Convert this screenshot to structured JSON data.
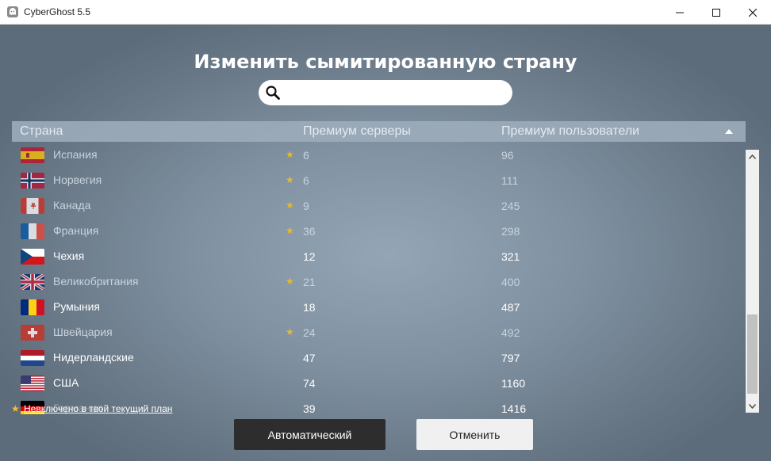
{
  "window": {
    "title": "CyberGhost 5.5",
    "app_icon": "ghost-icon",
    "controls": [
      "minimize-icon",
      "maximize-icon",
      "close-icon"
    ]
  },
  "heading": "Изменить сымитированную страну",
  "search": {
    "icon": "search-icon",
    "value": "",
    "placeholder": ""
  },
  "table": {
    "columns": [
      "Страна",
      "Премиум серверы",
      "Премиум пользователи"
    ],
    "sort": "ascending",
    "rows": [
      {
        "country": "Испания",
        "flag": "flag-spain",
        "premium": true,
        "servers": "6",
        "users": "96"
      },
      {
        "country": "Норвегия",
        "flag": "flag-norway",
        "premium": true,
        "servers": "6",
        "users": "111"
      },
      {
        "country": "Канада",
        "flag": "flag-canada",
        "premium": true,
        "servers": "9",
        "users": "245"
      },
      {
        "country": "Франция",
        "flag": "flag-france",
        "premium": true,
        "servers": "36",
        "users": "298"
      },
      {
        "country": "Чехия",
        "flag": "flag-czechia",
        "premium": false,
        "servers": "12",
        "users": "321"
      },
      {
        "country": "Великобритания",
        "flag": "flag-uk",
        "premium": true,
        "servers": "21",
        "users": "400"
      },
      {
        "country": "Румыния",
        "flag": "flag-romania",
        "premium": false,
        "servers": "18",
        "users": "487"
      },
      {
        "country": "Швейцария",
        "flag": "flag-switzerland",
        "premium": true,
        "servers": "24",
        "users": "492"
      },
      {
        "country": "Нидерландские",
        "flag": "flag-netherlands",
        "premium": false,
        "servers": "47",
        "users": "797"
      },
      {
        "country": "США",
        "flag": "flag-usa",
        "premium": false,
        "servers": "74",
        "users": "1160"
      },
      {
        "country": "Германия",
        "flag": "flag-germany",
        "premium": false,
        "servers": "39",
        "users": "1416"
      }
    ]
  },
  "legend": {
    "icon": "star-icon",
    "text": "Невключено в твой текущий план"
  },
  "buttons": {
    "auto": "Автоматический",
    "cancel": "Отменить"
  },
  "colors": {
    "premium_star": "#e7b92c",
    "auto_button": "#2d2d2d"
  }
}
